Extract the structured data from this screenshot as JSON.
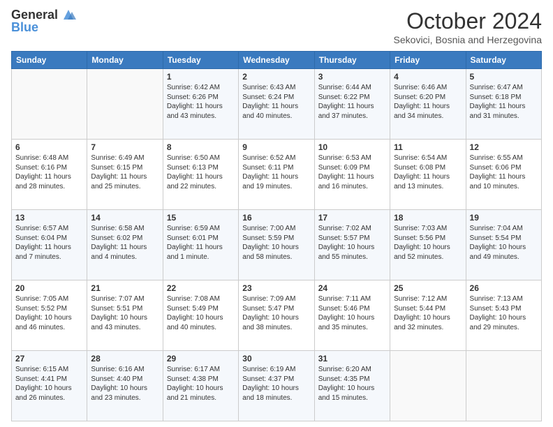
{
  "logo": {
    "line1": "General",
    "line2": "Blue"
  },
  "header": {
    "month": "October 2024",
    "location": "Sekovici, Bosnia and Herzegovina"
  },
  "weekdays": [
    "Sunday",
    "Monday",
    "Tuesday",
    "Wednesday",
    "Thursday",
    "Friday",
    "Saturday"
  ],
  "weeks": [
    [
      {
        "day": "",
        "sunrise": "",
        "sunset": "",
        "daylight": ""
      },
      {
        "day": "",
        "sunrise": "",
        "sunset": "",
        "daylight": ""
      },
      {
        "day": "1",
        "sunrise": "Sunrise: 6:42 AM",
        "sunset": "Sunset: 6:26 PM",
        "daylight": "Daylight: 11 hours and 43 minutes."
      },
      {
        "day": "2",
        "sunrise": "Sunrise: 6:43 AM",
        "sunset": "Sunset: 6:24 PM",
        "daylight": "Daylight: 11 hours and 40 minutes."
      },
      {
        "day": "3",
        "sunrise": "Sunrise: 6:44 AM",
        "sunset": "Sunset: 6:22 PM",
        "daylight": "Daylight: 11 hours and 37 minutes."
      },
      {
        "day": "4",
        "sunrise": "Sunrise: 6:46 AM",
        "sunset": "Sunset: 6:20 PM",
        "daylight": "Daylight: 11 hours and 34 minutes."
      },
      {
        "day": "5",
        "sunrise": "Sunrise: 6:47 AM",
        "sunset": "Sunset: 6:18 PM",
        "daylight": "Daylight: 11 hours and 31 minutes."
      }
    ],
    [
      {
        "day": "6",
        "sunrise": "Sunrise: 6:48 AM",
        "sunset": "Sunset: 6:16 PM",
        "daylight": "Daylight: 11 hours and 28 minutes."
      },
      {
        "day": "7",
        "sunrise": "Sunrise: 6:49 AM",
        "sunset": "Sunset: 6:15 PM",
        "daylight": "Daylight: 11 hours and 25 minutes."
      },
      {
        "day": "8",
        "sunrise": "Sunrise: 6:50 AM",
        "sunset": "Sunset: 6:13 PM",
        "daylight": "Daylight: 11 hours and 22 minutes."
      },
      {
        "day": "9",
        "sunrise": "Sunrise: 6:52 AM",
        "sunset": "Sunset: 6:11 PM",
        "daylight": "Daylight: 11 hours and 19 minutes."
      },
      {
        "day": "10",
        "sunrise": "Sunrise: 6:53 AM",
        "sunset": "Sunset: 6:09 PM",
        "daylight": "Daylight: 11 hours and 16 minutes."
      },
      {
        "day": "11",
        "sunrise": "Sunrise: 6:54 AM",
        "sunset": "Sunset: 6:08 PM",
        "daylight": "Daylight: 11 hours and 13 minutes."
      },
      {
        "day": "12",
        "sunrise": "Sunrise: 6:55 AM",
        "sunset": "Sunset: 6:06 PM",
        "daylight": "Daylight: 11 hours and 10 minutes."
      }
    ],
    [
      {
        "day": "13",
        "sunrise": "Sunrise: 6:57 AM",
        "sunset": "Sunset: 6:04 PM",
        "daylight": "Daylight: 11 hours and 7 minutes."
      },
      {
        "day": "14",
        "sunrise": "Sunrise: 6:58 AM",
        "sunset": "Sunset: 6:02 PM",
        "daylight": "Daylight: 11 hours and 4 minutes."
      },
      {
        "day": "15",
        "sunrise": "Sunrise: 6:59 AM",
        "sunset": "Sunset: 6:01 PM",
        "daylight": "Daylight: 11 hours and 1 minute."
      },
      {
        "day": "16",
        "sunrise": "Sunrise: 7:00 AM",
        "sunset": "Sunset: 5:59 PM",
        "daylight": "Daylight: 10 hours and 58 minutes."
      },
      {
        "day": "17",
        "sunrise": "Sunrise: 7:02 AM",
        "sunset": "Sunset: 5:57 PM",
        "daylight": "Daylight: 10 hours and 55 minutes."
      },
      {
        "day": "18",
        "sunrise": "Sunrise: 7:03 AM",
        "sunset": "Sunset: 5:56 PM",
        "daylight": "Daylight: 10 hours and 52 minutes."
      },
      {
        "day": "19",
        "sunrise": "Sunrise: 7:04 AM",
        "sunset": "Sunset: 5:54 PM",
        "daylight": "Daylight: 10 hours and 49 minutes."
      }
    ],
    [
      {
        "day": "20",
        "sunrise": "Sunrise: 7:05 AM",
        "sunset": "Sunset: 5:52 PM",
        "daylight": "Daylight: 10 hours and 46 minutes."
      },
      {
        "day": "21",
        "sunrise": "Sunrise: 7:07 AM",
        "sunset": "Sunset: 5:51 PM",
        "daylight": "Daylight: 10 hours and 43 minutes."
      },
      {
        "day": "22",
        "sunrise": "Sunrise: 7:08 AM",
        "sunset": "Sunset: 5:49 PM",
        "daylight": "Daylight: 10 hours and 40 minutes."
      },
      {
        "day": "23",
        "sunrise": "Sunrise: 7:09 AM",
        "sunset": "Sunset: 5:47 PM",
        "daylight": "Daylight: 10 hours and 38 minutes."
      },
      {
        "day": "24",
        "sunrise": "Sunrise: 7:11 AM",
        "sunset": "Sunset: 5:46 PM",
        "daylight": "Daylight: 10 hours and 35 minutes."
      },
      {
        "day": "25",
        "sunrise": "Sunrise: 7:12 AM",
        "sunset": "Sunset: 5:44 PM",
        "daylight": "Daylight: 10 hours and 32 minutes."
      },
      {
        "day": "26",
        "sunrise": "Sunrise: 7:13 AM",
        "sunset": "Sunset: 5:43 PM",
        "daylight": "Daylight: 10 hours and 29 minutes."
      }
    ],
    [
      {
        "day": "27",
        "sunrise": "Sunrise: 6:15 AM",
        "sunset": "Sunset: 4:41 PM",
        "daylight": "Daylight: 10 hours and 26 minutes."
      },
      {
        "day": "28",
        "sunrise": "Sunrise: 6:16 AM",
        "sunset": "Sunset: 4:40 PM",
        "daylight": "Daylight: 10 hours and 23 minutes."
      },
      {
        "day": "29",
        "sunrise": "Sunrise: 6:17 AM",
        "sunset": "Sunset: 4:38 PM",
        "daylight": "Daylight: 10 hours and 21 minutes."
      },
      {
        "day": "30",
        "sunrise": "Sunrise: 6:19 AM",
        "sunset": "Sunset: 4:37 PM",
        "daylight": "Daylight: 10 hours and 18 minutes."
      },
      {
        "day": "31",
        "sunrise": "Sunrise: 6:20 AM",
        "sunset": "Sunset: 4:35 PM",
        "daylight": "Daylight: 10 hours and 15 minutes."
      },
      {
        "day": "",
        "sunrise": "",
        "sunset": "",
        "daylight": ""
      },
      {
        "day": "",
        "sunrise": "",
        "sunset": "",
        "daylight": ""
      }
    ]
  ]
}
